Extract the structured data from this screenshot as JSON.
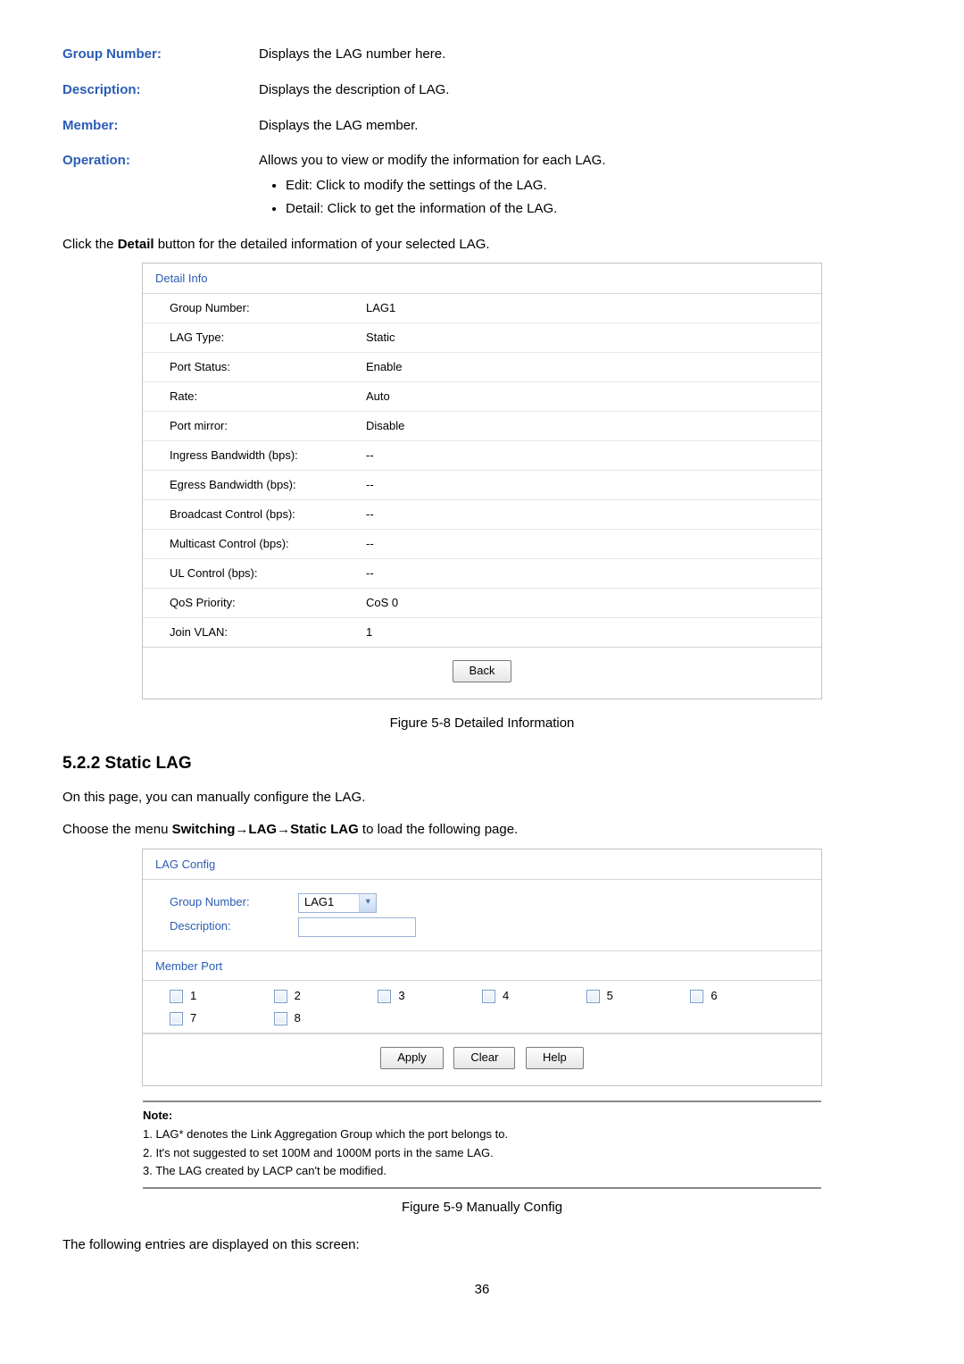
{
  "defs": {
    "group_number": {
      "label": "Group Number:",
      "text": "Displays the LAG number here."
    },
    "description": {
      "label": "Description:",
      "text": "Displays the description of LAG."
    },
    "member": {
      "label": "Member:",
      "text": "Displays the LAG member."
    },
    "operation": {
      "label": "Operation:",
      "text": "Allows you to view or modify the information for each LAG.",
      "b1": "Edit: Click to modify the settings of the LAG.",
      "b2": "Detail: Click to get the information of the LAG."
    }
  },
  "para_click_detail_pre": "Click the ",
  "para_click_detail_bold": "Detail",
  "para_click_detail_post": " button for the detailed information of your selected LAG.",
  "detail_info": {
    "title": "Detail Info",
    "rows": {
      "group_number": {
        "k": "Group Number:",
        "v": "LAG1"
      },
      "lag_type": {
        "k": "LAG Type:",
        "v": "Static"
      },
      "port_status": {
        "k": "Port Status:",
        "v": "Enable"
      },
      "rate": {
        "k": "Rate:",
        "v": "Auto"
      },
      "port_mirror": {
        "k": "Port mirror:",
        "v": "Disable"
      },
      "ingress_bw": {
        "k": "Ingress Bandwidth (bps):",
        "v": "--"
      },
      "egress_bw": {
        "k": "Egress Bandwidth (bps):",
        "v": "--"
      },
      "broadcast": {
        "k": "Broadcast Control (bps):",
        "v": "--"
      },
      "multicast": {
        "k": "Multicast Control (bps):",
        "v": "--"
      },
      "ul": {
        "k": "UL Control (bps):",
        "v": "--"
      },
      "qos": {
        "k": "QoS Priority:",
        "v": "CoS 0"
      },
      "vlan": {
        "k": "Join VLAN:",
        "v": "1"
      }
    },
    "back_btn": "Back"
  },
  "fig58": "Figure 5-8 Detailed Information",
  "h_522": "5.2.2 Static LAG",
  "p_522a": "On this page, you can manually configure the LAG.",
  "p_522b_pre": "Choose the menu ",
  "p_522b_bold": "Switching→LAG→Static LAG",
  "p_522b_post": " to load the following page.",
  "lag_config": {
    "title": "LAG Config",
    "group_number_label": "Group Number:",
    "group_number_value": "LAG1",
    "description_label": "Description:",
    "member_title": "Member Port",
    "ports": {
      "p1": "1",
      "p2": "2",
      "p3": "3",
      "p4": "4",
      "p5": "5",
      "p6": "6",
      "p7": "7",
      "p8": "8"
    },
    "apply": "Apply",
    "clear": "Clear",
    "help": "Help"
  },
  "note": {
    "title": "Note:",
    "l1": "1. LAG* denotes the Link Aggregation Group which the port belongs to.",
    "l2": "2. It's not suggested to set 100M and 1000M ports in the same LAG.",
    "l3": "3. The LAG created by LACP can't be modified."
  },
  "fig59": "Figure 5-9 Manually Config",
  "trailing": "The following entries are displayed on this screen:",
  "pagenum": "36"
}
